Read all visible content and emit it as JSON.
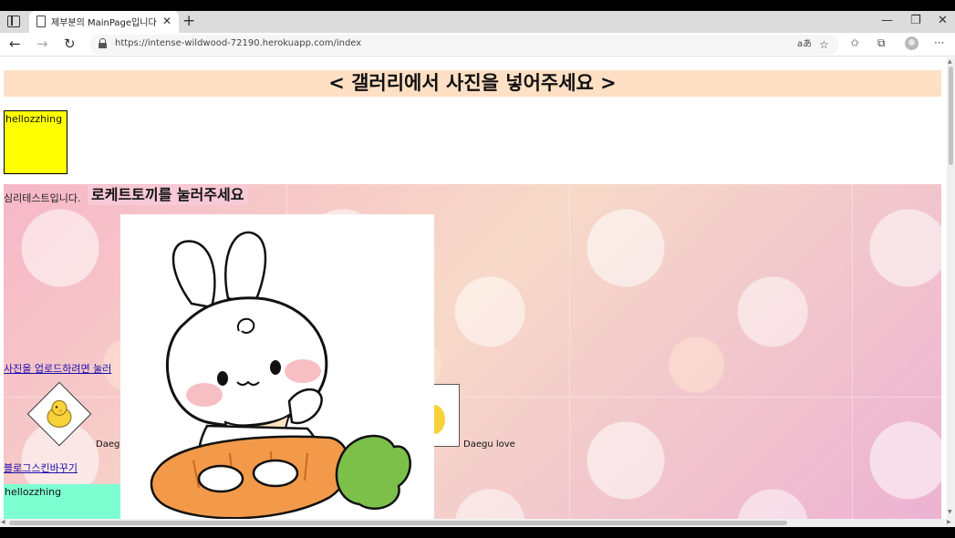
{
  "browser": {
    "tab_title": "제부분의 MainPage입니다",
    "url": "https://intense-wildwood-72190.herokuapp.com/index"
  },
  "page": {
    "gallery_header": "< 갤러리에서 사진을 넣어주세요 >",
    "yellow_box_text": "hellozzhing",
    "psych_test_text": "심리테스트입니다.",
    "rocket_label": "로케트토끼를 눌러주세요",
    "upload_link": "사진을 업로드하려면 눌러",
    "daegu_left": "Daeg",
    "skin_link": "블로그스킨바꾸기",
    "mint_box_text": "hellozzhing",
    "daegu_right": "Daegu love"
  },
  "icons": [
    "sidebar-toggle-icon",
    "page-icon",
    "close-icon",
    "plus-icon",
    "back-icon",
    "forward-icon",
    "refresh-icon",
    "lock-icon",
    "read-aloud-icon",
    "add-favorite-icon",
    "favorites-icon",
    "collections-icon",
    "profile-icon",
    "more-icon"
  ]
}
